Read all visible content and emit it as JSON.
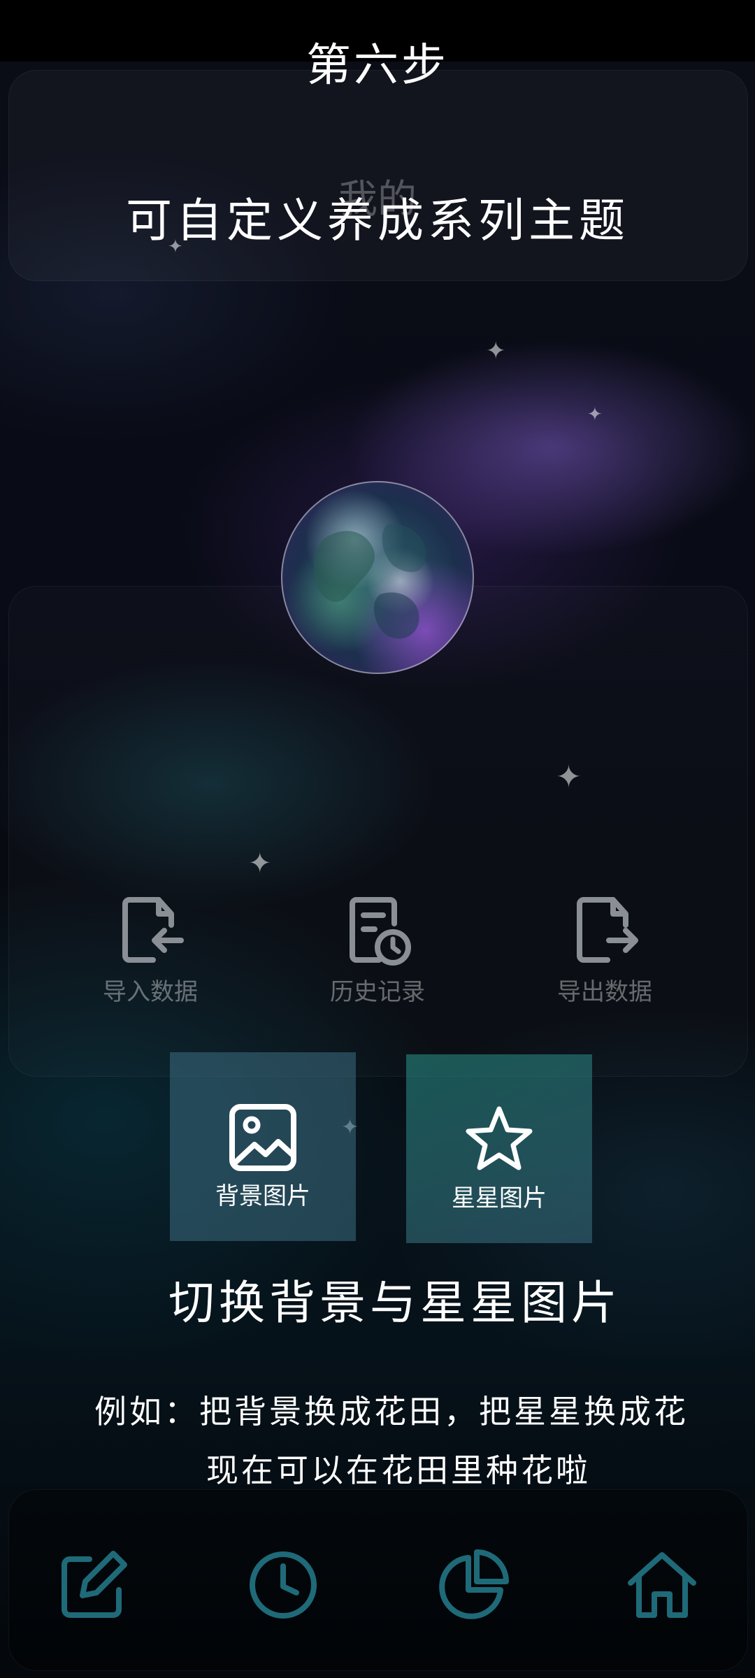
{
  "step_title": "第六步",
  "page_heading": "我的",
  "headline": "可自定义养成系列主题",
  "actions": [
    {
      "label": "导入数据",
      "icon": "import-file-icon"
    },
    {
      "label": "历史记录",
      "icon": "history-document-icon"
    },
    {
      "label": "导出数据",
      "icon": "export-file-icon"
    }
  ],
  "tiles": [
    {
      "label": "背景图片",
      "icon": "image-icon"
    },
    {
      "label": "星星图片",
      "icon": "star-icon"
    }
  ],
  "switch_title": "切换背景与星星图片",
  "description": {
    "line1": "例如：把背景换成花田，把星星换成花",
    "line2": "现在可以在花田里种花啦"
  },
  "bottom_nav": [
    {
      "icon": "edit-icon"
    },
    {
      "icon": "clock-icon"
    },
    {
      "icon": "pie-chart-icon"
    },
    {
      "icon": "home-icon"
    }
  ],
  "colors": {
    "nav_icon": "#1f6a78",
    "action_icon": "#8a8f96",
    "tile_bg": "#3c6e82"
  }
}
